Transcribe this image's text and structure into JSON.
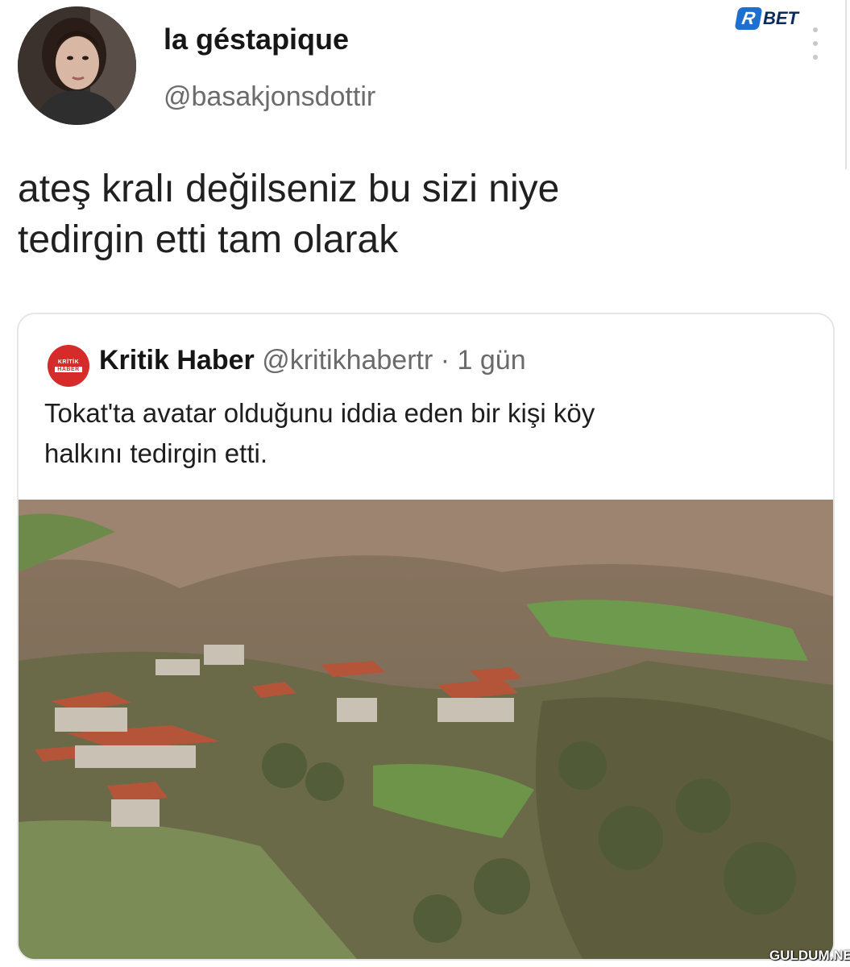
{
  "tweet": {
    "author": {
      "display_name": "la géstapique",
      "handle": "@basakjonsdottir",
      "avatar_icon": "profile-photo"
    },
    "text_lines": [
      "ateş kralı değilseniz bu sizi niye",
      "tedirgin etti tam olarak"
    ],
    "more_icon": "vertical-ellipsis-icon"
  },
  "quoted_tweet": {
    "avatar": {
      "line1": "KRİTİK",
      "line2": "HABER"
    },
    "author_name": "Kritik Haber",
    "handle": "@kritikhabertr",
    "separator": "·",
    "time": "1 gün",
    "text_lines": [
      "Tokat'ta avatar olduğunu iddia eden bir kişi köy",
      "halkını tedirgin etti."
    ],
    "image": "village-hillside-photo"
  },
  "branding": {
    "logo_mark": "R",
    "logo_text": "BET",
    "logo_color": "#1f6fd1",
    "watermark": "GULDUM.NET"
  }
}
